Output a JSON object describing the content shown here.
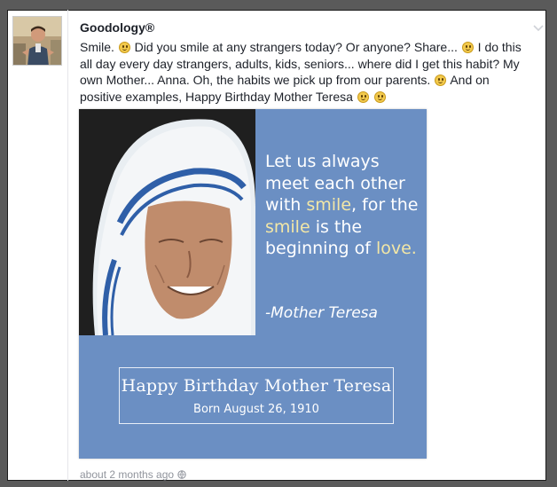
{
  "post": {
    "author": "Goodology®",
    "text_segments": [
      "Smile. ",
      " Did you smile at any strangers today? Or anyone? Share... ",
      " I do this all day every day strangers, adults, kids, seniors... where did I get this habit? My own Mother... Anna. Oh, the habits we pick up from our parents. ",
      " And on positive examples, Happy Birthday Mother Teresa ",
      " "
    ],
    "emoji_icon": "smile-emoji-icon",
    "timestamp": "about 2 months ago"
  },
  "card": {
    "quote_parts": [
      "Let us always meet each other with ",
      "smile",
      ", for the ",
      "smile",
      " is the beginning of ",
      "love",
      "."
    ],
    "attribution": "-Mother Teresa",
    "birthday_title": "Happy Birthday Mother Teresa",
    "birthday_date": "Born August 26, 1910",
    "colors": {
      "background": "#6b8fc3",
      "highlight": "#f3e7a6",
      "text": "#ffffff"
    }
  },
  "icons": [
    "chevron-down-icon",
    "globe-icon"
  ]
}
